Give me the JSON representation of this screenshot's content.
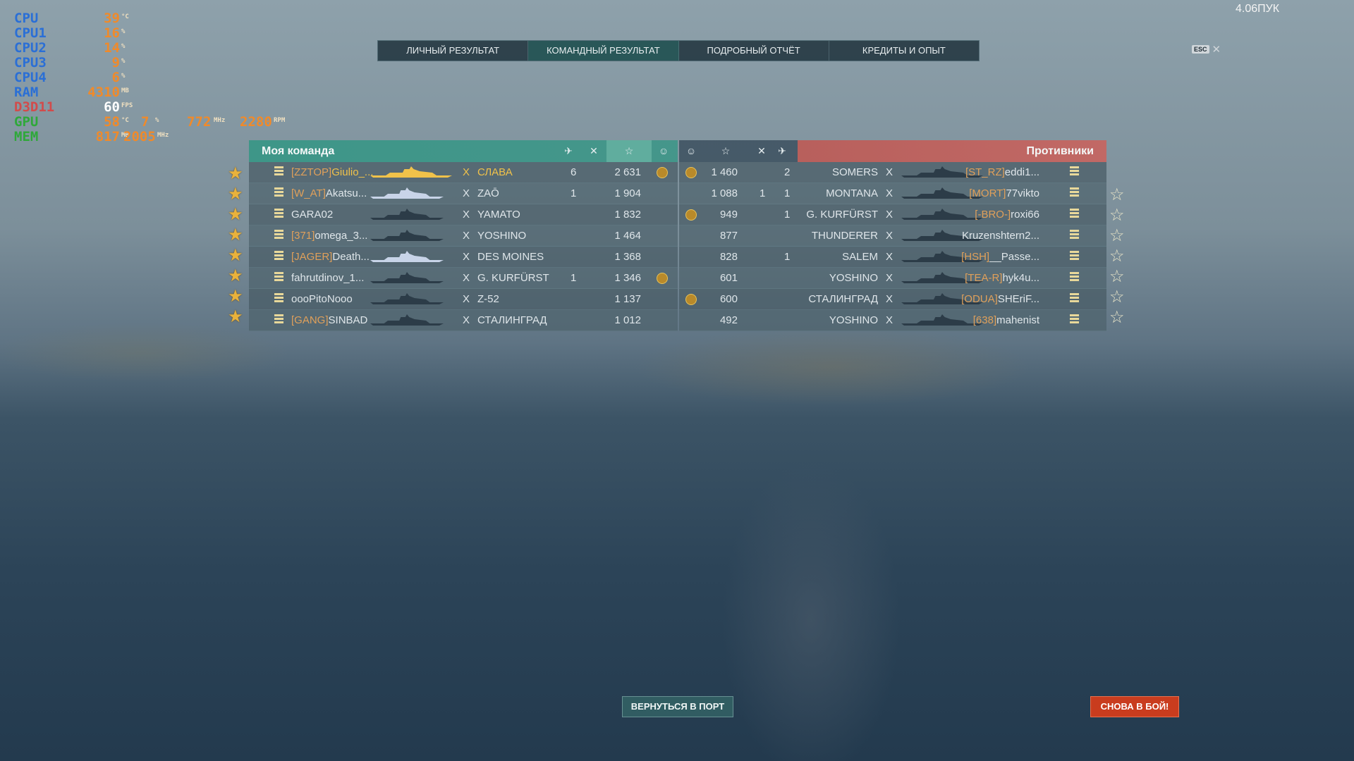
{
  "hud": {
    "rows": [
      {
        "label": "CPU",
        "value": "39",
        "unit": "°C"
      },
      {
        "label": "CPU1",
        "value": "16",
        "unit": "%"
      },
      {
        "label": "CPU2",
        "value": "14",
        "unit": "%"
      },
      {
        "label": "CPU3",
        "value": "9",
        "unit": "%"
      },
      {
        "label": "CPU4",
        "value": "6",
        "unit": "%"
      },
      {
        "label": "RAM",
        "value": "4310",
        "unit": "MB"
      },
      {
        "label": "D3D11",
        "value": "60",
        "unit": "FPS"
      },
      {
        "label": "GPU",
        "value": "58",
        "unit": "°C",
        "extra": [
          {
            "value": "7",
            "unit": "%"
          },
          {
            "value": "772",
            "unit": "MHz"
          },
          {
            "value": "2280",
            "unit": "RPM"
          }
        ]
      },
      {
        "label": "MEM",
        "value": "817",
        "unit": "MB",
        "extra": [
          {
            "value": "2005",
            "unit": "MHz"
          }
        ]
      }
    ]
  },
  "fps_top": "4.06ПУК",
  "tabs": [
    "ЛИЧНЫЙ РЕЗУЛЬТАТ",
    "КОМАНДНЫЙ РЕЗУЛЬТАТ",
    "ПОДРОБНЫЙ ОТЧЁТ",
    "КРЕДИТЫ И ОПЫТ"
  ],
  "active_tab": 1,
  "esc_label": "ESC",
  "my_team": {
    "title": "Моя команда",
    "rows": [
      {
        "clan": "[ZZTOP]",
        "player": "Giulio_...",
        "x": "X",
        "ship": "СЛАВА",
        "kills": "6",
        "score": "2 631",
        "medal": true,
        "me": true
      },
      {
        "clan": "[W_AT]",
        "player": "Akatsu...",
        "x": "X",
        "ship": "ZAŌ",
        "kills": "1",
        "score": "1 904",
        "medal": false
      },
      {
        "clan": "",
        "player": "GARA02",
        "x": "X",
        "ship": "YAMATO",
        "kills": "",
        "score": "1 832",
        "medal": false
      },
      {
        "clan": "[371]",
        "player": "omega_3...",
        "x": "X",
        "ship": "YOSHINO",
        "kills": "",
        "score": "1 464",
        "medal": false
      },
      {
        "clan": "[JAGER]",
        "player": "Death...",
        "x": "X",
        "ship": "DES MOINES",
        "kills": "",
        "score": "1 368",
        "medal": false
      },
      {
        "clan": "",
        "player": "fahrutdinov_1...",
        "x": "X",
        "ship": "G. KURFÜRST",
        "kills": "1",
        "score": "1 346",
        "medal": true
      },
      {
        "clan": "",
        "player": "oooPitoNooo",
        "x": "X",
        "ship": "Z-52",
        "kills": "",
        "score": "1 137",
        "medal": false
      },
      {
        "clan": "[GANG]",
        "player": "SINBAD",
        "x": "X",
        "ship": "СТАЛИНГРАД",
        "kills": "",
        "score": "1 012",
        "medal": false
      }
    ]
  },
  "enemies": {
    "title": "Противники",
    "rows": [
      {
        "medal": true,
        "score": "1 460",
        "planes": "",
        "kills": "2",
        "ship": "SOMERS",
        "x": "X",
        "clan": "[ST_RZ]",
        "player": "eddi1..."
      },
      {
        "medal": false,
        "score": "1 088",
        "planes": "1",
        "kills": "1",
        "ship": "MONTANA",
        "x": "X",
        "clan": "[MORT]",
        "player": "77vikto"
      },
      {
        "medal": true,
        "score": "949",
        "planes": "",
        "kills": "1",
        "ship": "G. KURFÜRST",
        "x": "X",
        "clan": "[-BRO-]",
        "player": "roxi66"
      },
      {
        "medal": false,
        "score": "877",
        "planes": "",
        "kills": "",
        "ship": "THUNDERER",
        "x": "X",
        "clan": "",
        "player": "Kruzenshtern2..."
      },
      {
        "medal": false,
        "score": "828",
        "planes": "",
        "kills": "1",
        "ship": "SALEM",
        "x": "X",
        "clan": "[HSH]",
        "player": "__Passe..."
      },
      {
        "medal": false,
        "score": "601",
        "planes": "",
        "kills": "",
        "ship": "YOSHINO",
        "x": "X",
        "clan": "[TEA-R]",
        "player": "hyk4u..."
      },
      {
        "medal": true,
        "score": "600",
        "planes": "",
        "kills": "",
        "ship": "СТАЛИНГРАД",
        "x": "X",
        "clan": "[ODUA]",
        "player": "SHEriF..."
      },
      {
        "medal": false,
        "score": "492",
        "planes": "",
        "kills": "",
        "ship": "YOSHINO",
        "x": "X",
        "clan": "[638]",
        "player": "mahenist"
      }
    ]
  },
  "buttons": {
    "port": "ВЕРНУТЬСЯ В ПОРТ",
    "battle": "СНОВА В БОЙ!"
  }
}
